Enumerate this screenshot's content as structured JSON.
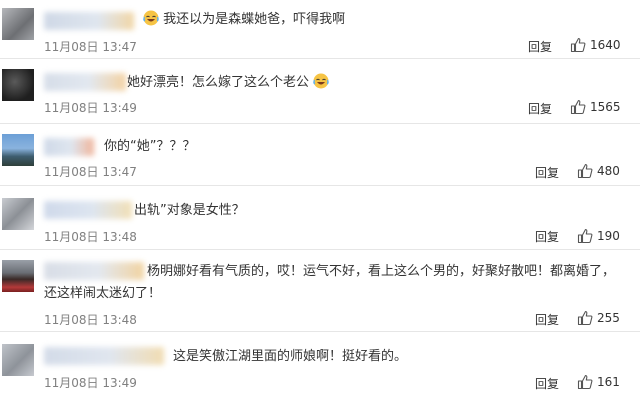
{
  "comments": [
    {
      "text": "我还以为是森蝶她爸，吓得我啊",
      "time": "11月08日 13:47",
      "reply": "回复",
      "likes": "1640"
    },
    {
      "text": "她好漂亮！怎么嫁了这么个老公",
      "time": "11月08日 13:49",
      "reply": "回复",
      "likes": "1565"
    },
    {
      "text": "你的“她”？？？",
      "time": "11月08日 13:47",
      "reply": "回复",
      "likes": "480"
    },
    {
      "text": "出轨”对象是女性？",
      "time": "11月08日 13:48",
      "reply": "回复",
      "likes": "190"
    },
    {
      "text": "杨明娜好看有气质的，哎！运气不好，看上这么个男的，好聚好散吧！都离婚了，还这样闹太迷幻了！",
      "time": "11月08日 13:48",
      "reply": "回复",
      "likes": "255"
    },
    {
      "text": "这是笑傲江湖里面的师娘啊！挺好看的。",
      "time": "11月08日 13:49",
      "reply": "回复",
      "likes": "161"
    }
  ],
  "icons": {
    "like": "thumbs-up-icon",
    "emoji": "laughing-crying-emoji-icon"
  }
}
